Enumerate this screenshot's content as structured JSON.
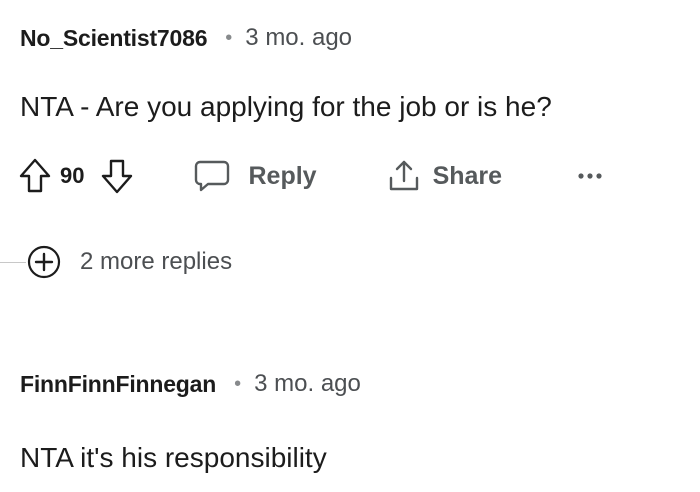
{
  "comments": [
    {
      "username": "No_Scientist7086",
      "separator": "•",
      "age": "3 mo. ago",
      "text": "NTA - Are you applying for the job or is he?",
      "score": "90",
      "reply_label": "Reply",
      "share_label": "Share",
      "more_label": "···"
    },
    {
      "username": "FinnFinnFinnegan",
      "separator": "•",
      "age": "3 mo. ago",
      "text": "NTA it's his responsibility"
    }
  ],
  "more_replies": {
    "label": "2 more replies"
  },
  "colors": {
    "text": "#1c1c1c",
    "muted": "#4c4f52",
    "icon": "#1c1c1c"
  }
}
